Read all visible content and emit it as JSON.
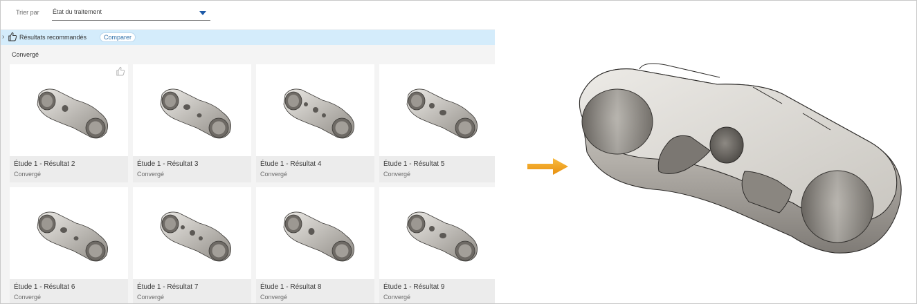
{
  "sort": {
    "label": "Trier par",
    "value": "État du traitement"
  },
  "recommended": {
    "label": "Résultats recommandés",
    "compare_label": "Comparer"
  },
  "group": {
    "label": "Convergé"
  },
  "cards": [
    {
      "title": "Étude 1 - Résultat 2",
      "status": "Convergé",
      "variant": 0
    },
    {
      "title": "Étude 1 - Résultat 3",
      "status": "Convergé",
      "variant": 1
    },
    {
      "title": "Étude 1 - Résultat 4",
      "status": "Convergé",
      "variant": 2
    },
    {
      "title": "Étude 1 - Résultat 5",
      "status": "Convergé",
      "variant": 3
    },
    {
      "title": "Étude 1 - Résultat 6",
      "status": "Convergé",
      "variant": 1
    },
    {
      "title": "Étude 1 - Résultat 7",
      "status": "Convergé",
      "variant": 2
    },
    {
      "title": "Étude 1 - Résultat 8",
      "status": "Convergé",
      "variant": 0
    },
    {
      "title": "Étude 1 - Résultat 9",
      "status": "Convergé",
      "variant": 3
    }
  ],
  "icons": {
    "sort_caret": "chevron-down-icon",
    "expand": "chevron-right-icon",
    "recommended": "thumbs-up-icon",
    "arrow": "arrow-right-icon"
  },
  "colors": {
    "accent_blue": "#1e5aa8",
    "recommended_bar": "#d4ecfb",
    "arrow_orange": "#f3a31b",
    "metal_light": "#dcdad6",
    "metal_dark": "#8d8a85"
  }
}
